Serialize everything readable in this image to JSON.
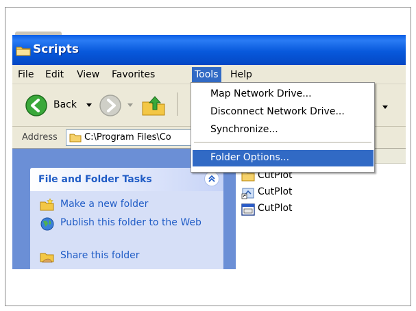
{
  "window": {
    "title": "Scripts"
  },
  "menubar": {
    "items": [
      {
        "label": "File"
      },
      {
        "label": "Edit"
      },
      {
        "label": "View"
      },
      {
        "label": "Favorites"
      },
      {
        "label": "Tools"
      },
      {
        "label": "Help"
      }
    ]
  },
  "toolbar": {
    "back_label": "Back"
  },
  "address": {
    "label": "Address",
    "value": "C:\\Program Files\\Co"
  },
  "tools_menu": {
    "items": [
      {
        "label": "Map Network Drive..."
      },
      {
        "label": "Disconnect Network Drive..."
      },
      {
        "label": "Synchronize..."
      },
      {
        "label": "Folder Options..."
      }
    ]
  },
  "task_pane": {
    "title": "File and Folder Tasks",
    "tasks": [
      {
        "label": "Make a new folder",
        "icon": "new-folder-icon"
      },
      {
        "label": "Publish this folder to the Web",
        "icon": "globe-icon"
      },
      {
        "label": "Share this folder",
        "icon": "share-folder-icon"
      }
    ]
  },
  "files": [
    {
      "name": "CutPlot",
      "icon": "folder-icon"
    },
    {
      "name": "CutPlot",
      "icon": "shortcut-icon"
    },
    {
      "name": "CutPlot",
      "icon": "application-icon"
    }
  ],
  "colors": {
    "titlebar": "#0859dc",
    "menu_highlight": "#316ac5",
    "task_pane_bg": "#6b8fd6",
    "task_link": "#215dc6"
  }
}
